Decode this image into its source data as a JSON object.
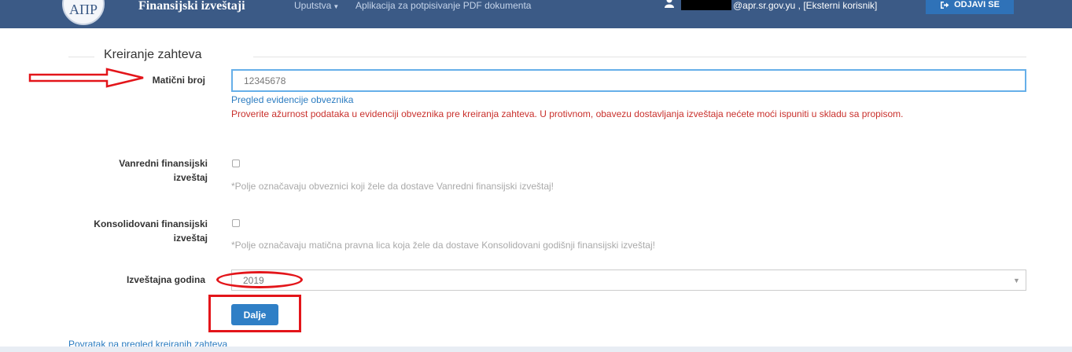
{
  "header": {
    "brand": "Finansijski izveštaji",
    "logo_text": "АПР",
    "nav": [
      {
        "label": "Uputstva",
        "has_dropdown": true
      },
      {
        "label": "Aplikacija za potpisivanje PDF dokumenta",
        "has_dropdown": false
      }
    ],
    "user_label": "@apr.sr.gov.yu , [Eksterni korisnik]",
    "logout_label": "ODJAVI SE",
    "icons": {
      "user": "user-icon",
      "logout": "sign-out-icon"
    }
  },
  "form": {
    "legend": "Kreiranje zahteva",
    "maticni_broj": {
      "label": "Matični broj",
      "value": "12345678"
    },
    "registry_link": "Pregled evidencije obveznika",
    "warning": "Proverite ažurnost podataka u evidenciji obveznika pre kreiranja zahteva. U protivnom, obavezu dostavljanja izveštaja nećete moći ispuniti u skladu sa propisom.",
    "vanredni": {
      "label_line1": "Vanredni finansijski",
      "label_line2": "izveštaj",
      "checked": false,
      "hint": "*Polje označavaju obveznici koji žele da dostave Vanredni finansijski izveštaj!"
    },
    "konsolidovani": {
      "label_line1": "Konsolidovani finansijski",
      "label_line2": "izveštaj",
      "checked": false,
      "hint": "*Polje označavaju matična pravna lica koja žele da dostave Konsolidovani godišnji finansijski izveštaj!"
    },
    "godina": {
      "label": "Izveštajna godina",
      "value": "2019"
    },
    "submit_label": "Dalje",
    "back_link": "Povratak na pregled kreiranih zahteva"
  },
  "colors": {
    "navbar": "#3b5a86",
    "primary_button": "#2f7fc6",
    "link": "#2a7bc0",
    "warning_text": "#c9302c",
    "annotation": "#e3151a"
  }
}
